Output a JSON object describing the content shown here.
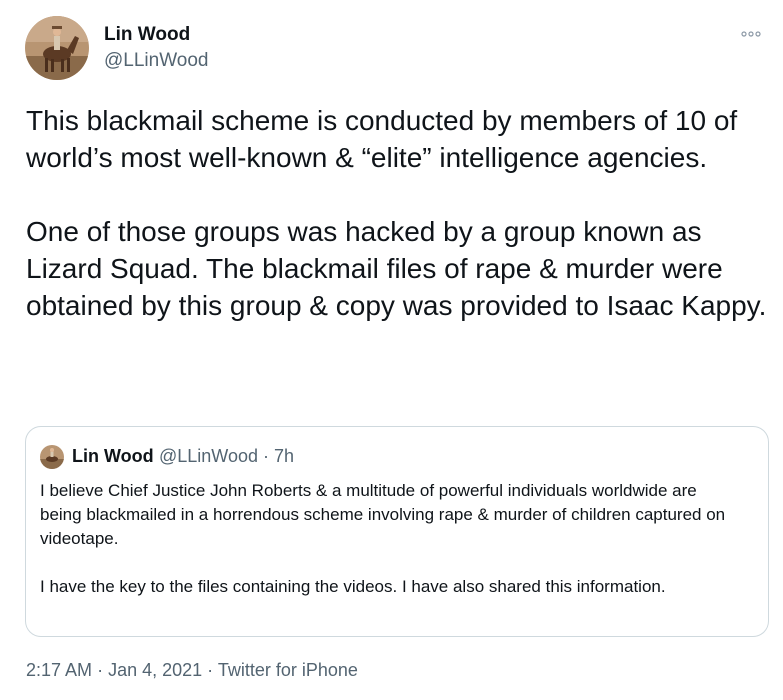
{
  "tweet": {
    "author": {
      "display_name": "Lin Wood",
      "handle": "@LLinWood",
      "avatar_icon": "avatar-horse-rider"
    },
    "more_icon": "more-options-icon",
    "body_paragraphs": [
      "This blackmail scheme is conducted by members of 10 of world’s most well-known & “elite” intelligence agencies.",
      "One of those groups was hacked by a group known as Lizard Squad. The blackmail files of rape & murder were obtained by this group & copy was provided to Isaac Kappy."
    ],
    "quote": {
      "display_name": "Lin Wood",
      "handle": "@LLinWood",
      "separator": "·",
      "time": "7h",
      "paragraphs": [
        "I believe Chief Justice John Roberts & a multitude of powerful individuals worldwide are being blackmailed in a horrendous scheme involving rape & murder of children captured on videotape.",
        "I have the key to the files containing the videos. I have also shared this information."
      ]
    },
    "meta": {
      "time": "2:17 AM",
      "separator": "·",
      "date": "Jan 4, 2021",
      "source": "Twitter for iPhone"
    },
    "colors": {
      "text": "#0f1419",
      "secondary": "#536471",
      "border": "#cfd9de"
    }
  }
}
